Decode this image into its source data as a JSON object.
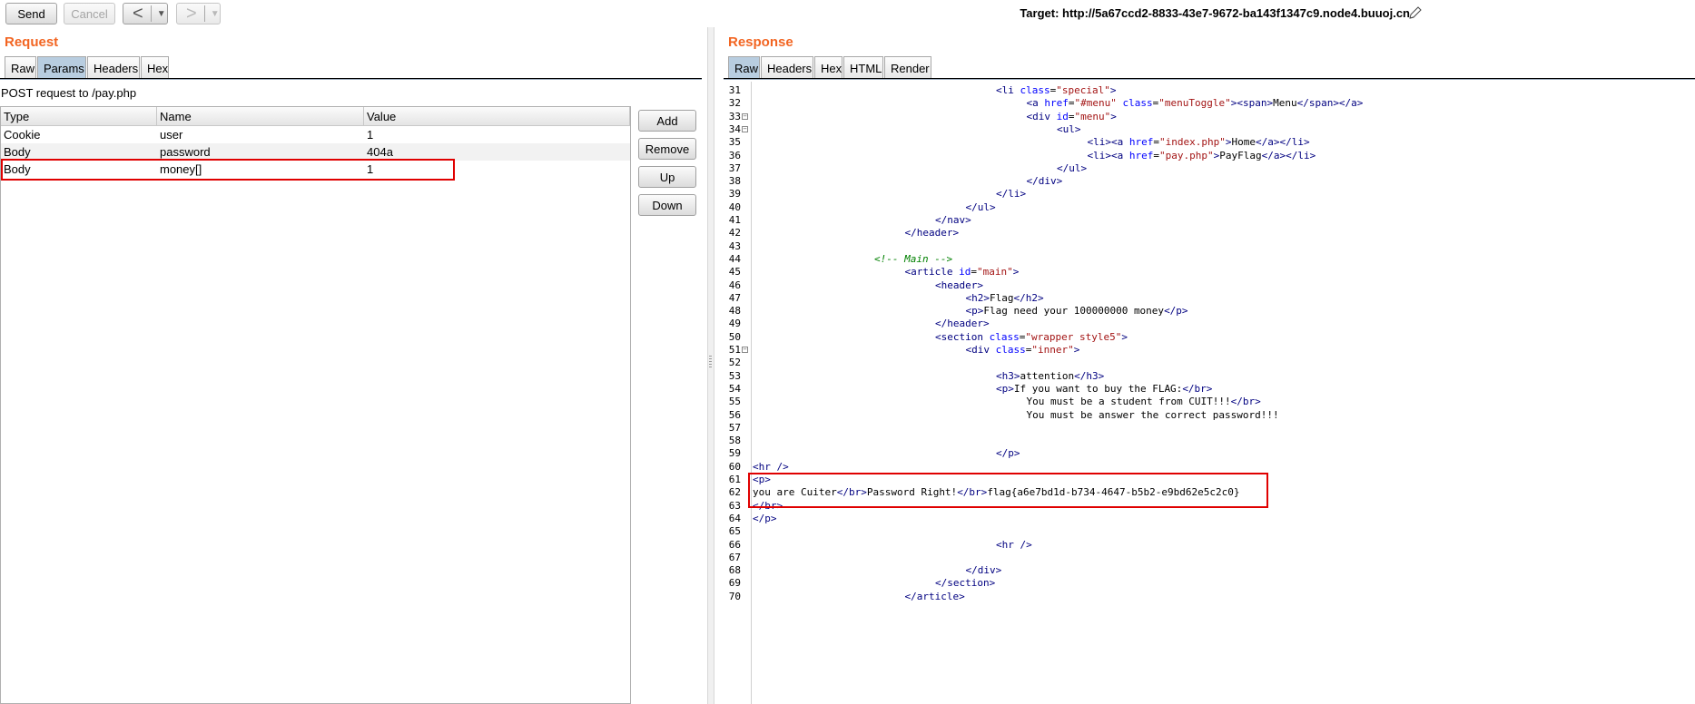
{
  "toolbar": {
    "send_label": "Send",
    "cancel_label": "Cancel",
    "back_glyph": "<",
    "forward_glyph": ">",
    "dropdown_glyph": "▼",
    "target_label": "Target: http://5a67ccd2-8833-43e7-9672-ba143f1347c9.node4.buuoj.cn",
    "edit_icon": "pencil-icon"
  },
  "request": {
    "title": "Request",
    "tabs": [
      "Raw",
      "Params",
      "Headers",
      "Hex"
    ],
    "active_tab": "Params",
    "post_line": "POST request to /pay.php",
    "columns": [
      "Type",
      "Name",
      "Value"
    ],
    "rows": [
      {
        "type": "Cookie",
        "name": "user",
        "value": "1"
      },
      {
        "type": "Body",
        "name": "password",
        "value": "404a"
      },
      {
        "type": "Body",
        "name": "money[]",
        "value": "1"
      }
    ],
    "buttons": [
      "Add",
      "Remove",
      "Up",
      "Down"
    ]
  },
  "response": {
    "title": "Response",
    "tabs": [
      "Raw",
      "Headers",
      "Hex",
      "HTML",
      "Render"
    ],
    "active_tab": "Raw",
    "lines": [
      {
        "n": "31",
        "fold": false,
        "indent": 8,
        "html": "<span class='tg'>&lt;li</span> <span class='at'>class</span>=<span class='av'>\"special\"</span><span class='tg'>&gt;</span>"
      },
      {
        "n": "32",
        "fold": false,
        "indent": 9,
        "html": "<span class='tg'>&lt;a</span> <span class='at'>href</span>=<span class='av'>\"#menu\"</span> <span class='at'>class</span>=<span class='av'>\"menuToggle\"</span><span class='tg'>&gt;&lt;span&gt;</span>Menu<span class='tg'>&lt;/span&gt;&lt;/a&gt;</span>"
      },
      {
        "n": "33",
        "fold": true,
        "indent": 9,
        "html": "<span class='tg'>&lt;div</span> <span class='at'>id</span>=<span class='av'>\"menu\"</span><span class='tg'>&gt;</span>"
      },
      {
        "n": "34",
        "fold": true,
        "indent": 10,
        "html": "<span class='tg'>&lt;ul&gt;</span>"
      },
      {
        "n": "35",
        "fold": false,
        "indent": 11,
        "html": "<span class='tg'>&lt;li&gt;&lt;a</span> <span class='at'>href</span>=<span class='av'>\"index.php\"</span><span class='tg'>&gt;</span>Home<span class='tg'>&lt;/a&gt;&lt;/li&gt;</span>"
      },
      {
        "n": "36",
        "fold": false,
        "indent": 11,
        "html": "<span class='tg'>&lt;li&gt;&lt;a</span> <span class='at'>href</span>=<span class='av'>\"pay.php\"</span><span class='tg'>&gt;</span>PayFlag<span class='tg'>&lt;/a&gt;&lt;/li&gt;</span>"
      },
      {
        "n": "37",
        "fold": false,
        "indent": 10,
        "html": "<span class='tg'>&lt;/ul&gt;</span>"
      },
      {
        "n": "38",
        "fold": false,
        "indent": 9,
        "html": "<span class='tg'>&lt;/div&gt;</span>"
      },
      {
        "n": "39",
        "fold": false,
        "indent": 8,
        "html": "<span class='tg'>&lt;/li&gt;</span>"
      },
      {
        "n": "40",
        "fold": false,
        "indent": 7,
        "html": "<span class='tg'>&lt;/ul&gt;</span>"
      },
      {
        "n": "41",
        "fold": false,
        "indent": 6,
        "html": "<span class='tg'>&lt;/nav&gt;</span>"
      },
      {
        "n": "42",
        "fold": false,
        "indent": 5,
        "html": "<span class='tg'>&lt;/header&gt;</span>"
      },
      {
        "n": "43",
        "fold": false,
        "indent": 0,
        "html": ""
      },
      {
        "n": "44",
        "fold": false,
        "indent": 4,
        "html": "<span class='cm'>&lt;!-- Main --&gt;</span>"
      },
      {
        "n": "45",
        "fold": false,
        "indent": 5,
        "html": "<span class='tg'>&lt;article</span> <span class='at'>id</span>=<span class='av'>\"main\"</span><span class='tg'>&gt;</span>"
      },
      {
        "n": "46",
        "fold": false,
        "indent": 6,
        "html": "<span class='tg'>&lt;header&gt;</span>"
      },
      {
        "n": "47",
        "fold": false,
        "indent": 7,
        "html": "<span class='tg'>&lt;h2&gt;</span>Flag<span class='tg'>&lt;/h2&gt;</span>"
      },
      {
        "n": "48",
        "fold": false,
        "indent": 7,
        "html": "<span class='tg'>&lt;p&gt;</span>Flag need your 100000000 money<span class='tg'>&lt;/p&gt;</span>"
      },
      {
        "n": "49",
        "fold": false,
        "indent": 6,
        "html": "<span class='tg'>&lt;/header&gt;</span>"
      },
      {
        "n": "50",
        "fold": false,
        "indent": 6,
        "html": "<span class='tg'>&lt;section</span> <span class='at'>class</span>=<span class='av'>\"wrapper style5\"</span><span class='tg'>&gt;</span>"
      },
      {
        "n": "51",
        "fold": true,
        "indent": 7,
        "html": "<span class='tg'>&lt;div</span> <span class='at'>class</span>=<span class='av'>\"inner\"</span><span class='tg'>&gt;</span>"
      },
      {
        "n": "52",
        "fold": false,
        "indent": 0,
        "html": ""
      },
      {
        "n": "53",
        "fold": false,
        "indent": 8,
        "html": "<span class='tg'>&lt;h3&gt;</span>attention<span class='tg'>&lt;/h3&gt;</span>"
      },
      {
        "n": "54",
        "fold": false,
        "indent": 8,
        "html": "<span class='tg'>&lt;p&gt;</span>If you want to buy the FLAG:<span class='tg'>&lt;/br&gt;</span>"
      },
      {
        "n": "55",
        "fold": false,
        "indent": 9,
        "html": "You must be a student from CUIT!!!<span class='tg'>&lt;/br&gt;</span>"
      },
      {
        "n": "56",
        "fold": false,
        "indent": 9,
        "html": "You must be answer the correct password!!!"
      },
      {
        "n": "57",
        "fold": false,
        "indent": 0,
        "html": ""
      },
      {
        "n": "58",
        "fold": false,
        "indent": 0,
        "html": ""
      },
      {
        "n": "59",
        "fold": false,
        "indent": 8,
        "html": "<span class='tg'>&lt;/p&gt;</span>"
      },
      {
        "n": "60",
        "fold": false,
        "indent": 0,
        "html": "<span class='tg'>&lt;hr /&gt;</span>"
      },
      {
        "n": "61",
        "fold": false,
        "indent": 0,
        "html": "<span class='tg'>&lt;p&gt;</span>"
      },
      {
        "n": "62",
        "fold": false,
        "indent": 0,
        "html": "you are Cuiter<span class='tg'>&lt;/br&gt;</span>Password Right!<span class='tg'>&lt;/br&gt;</span>flag{a6e7bd1d-b734-4647-b5b2-e9bd62e5c2c0}"
      },
      {
        "n": "63",
        "fold": false,
        "indent": 0,
        "html": "<span class='tg'>&lt;/br&gt;</span>"
      },
      {
        "n": "64",
        "fold": false,
        "indent": 0,
        "html": "<span class='tg'>&lt;/p&gt;</span>"
      },
      {
        "n": "65",
        "fold": false,
        "indent": 0,
        "html": ""
      },
      {
        "n": "66",
        "fold": false,
        "indent": 8,
        "html": "<span class='tg'>&lt;hr /&gt;</span>"
      },
      {
        "n": "67",
        "fold": false,
        "indent": 0,
        "html": ""
      },
      {
        "n": "68",
        "fold": false,
        "indent": 7,
        "html": "<span class='tg'>&lt;/div&gt;</span>"
      },
      {
        "n": "69",
        "fold": false,
        "indent": 6,
        "html": "<span class='tg'>&lt;/section&gt;</span>"
      },
      {
        "n": "70",
        "fold": false,
        "indent": 5,
        "html": "<span class='tg'>&lt;/article&gt;</span>"
      }
    ]
  },
  "colors": {
    "accent_orange": "#f26522",
    "highlight_red": "#e00000",
    "active_tab": "#b8cde0"
  }
}
